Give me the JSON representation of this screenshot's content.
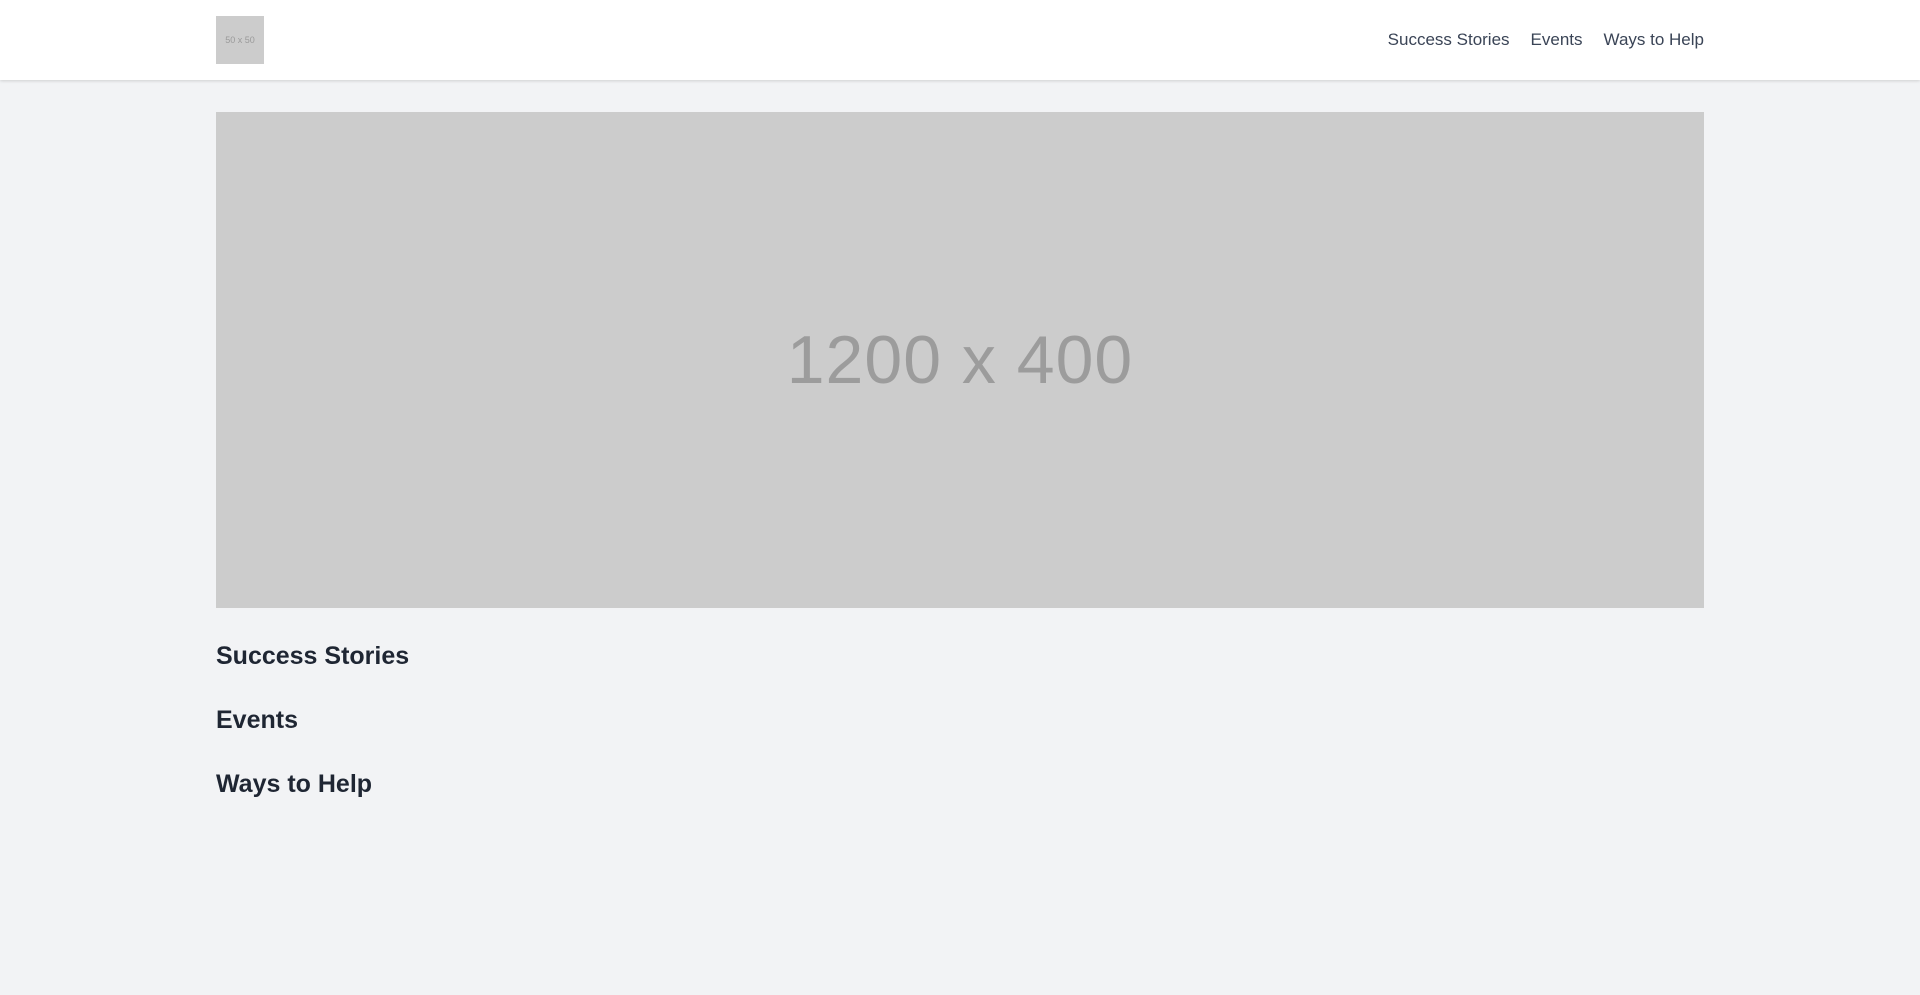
{
  "header": {
    "logo_text": "50 x 50",
    "nav": [
      {
        "label": "Success Stories"
      },
      {
        "label": "Events"
      },
      {
        "label": "Ways to Help"
      }
    ]
  },
  "hero": {
    "placeholder_text": "1200 x 400"
  },
  "sections": [
    {
      "heading": "Success Stories"
    },
    {
      "heading": "Events"
    },
    {
      "heading": "Ways to Help"
    }
  ],
  "colors": {
    "page_background": "#f2f3f5",
    "header_background": "#ffffff",
    "placeholder_gray": "#cccccc",
    "heading_text": "#1f2633",
    "nav_text": "#3a4456"
  }
}
